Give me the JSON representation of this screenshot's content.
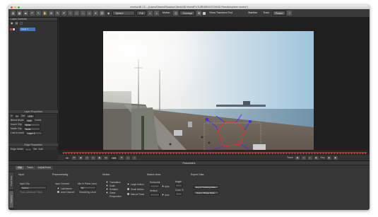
{
  "window": {
    "title": "mocha AE CC – [Users/Shared/Shadow/Clients/3D World/FUTUREBRIGHTON/3D Results/sphere.mocha*]"
  },
  "toolbar": {
    "layer_select": "Sphere",
    "zoom": "Full",
    "motion_label": "Motion",
    "overlays": "Overlays",
    "show_transform": "Show Transform Tool",
    "stabilize": "Stabilize",
    "track": "Track",
    "promo": "Promo"
  },
  "left_panel": {
    "layer_controls": "Layer Controls",
    "layer_name": "Layer 1",
    "layer_properties": "Layer Properties",
    "in_label": "In",
    "in_value": "0",
    "out_label": "Out",
    "out_value": "476",
    "blend_mode_label": "Blend Mode",
    "blend_mode_value": "Add",
    "invert_label": "Invert",
    "insert_clip_label": "Insert Clip",
    "insert_clip_value": "None",
    "matte_clip_label": "Matte Clip",
    "matte_clip_value": "None",
    "link_to_track_label": "Link to track",
    "link_to_track_value": "Layer 1",
    "edge_properties": "Edge Properties",
    "edge_width_label": "Edge Width",
    "set_label": "Set",
    "add_label": "Add"
  },
  "transport": {
    "frame_a": "476",
    "frame_b": "0",
    "track_label": "Track",
    "key_label": "Key"
  },
  "params": {
    "title": "Parameters",
    "tabs": [
      "Clip",
      "Track",
      "AdjustTrack"
    ],
    "side_tabs": [
      "Track Data",
      "Tracking"
    ],
    "input": {
      "title": "Input",
      "clip_label": "Input Clip",
      "clip_value": "Sphere",
      "track_label": "Track Individual Fields"
    },
    "preprocessing": {
      "title": "Preprocessing",
      "input_channel": "Input Channel",
      "luminance": "Luminance",
      "auto_channel": "Auto Channel",
      "min_pixels": "Min % Pixels Used",
      "min_value": "50",
      "smoothing": "Smoothing Level",
      "smoothing_value": "0"
    },
    "motion": {
      "title": "Motion",
      "translation": "Translation",
      "scale": "Scale",
      "rotation": "Rotation",
      "shear": "Shear",
      "perspective": "Perspective",
      "large": "Large Motion",
      "small": "Small Motion",
      "manual": "Manual Track"
    },
    "search_area": {
      "title": "Search Area",
      "horizontal": "Horizontal",
      "vertical": "Vertical",
      "auto": "Auto"
    },
    "angle": {
      "title": "Angle",
      "zoom": "Zoom %"
    },
    "export": {
      "title": "Export Data",
      "tracking": "Export Tracking Data...",
      "shape": "Export Shape Data..."
    }
  },
  "colors": {
    "timeline_red": "#c81e1e",
    "spline_blue": "#3b30ff",
    "spline_red": "#e23030",
    "layer_selected": "#3f74c9"
  }
}
